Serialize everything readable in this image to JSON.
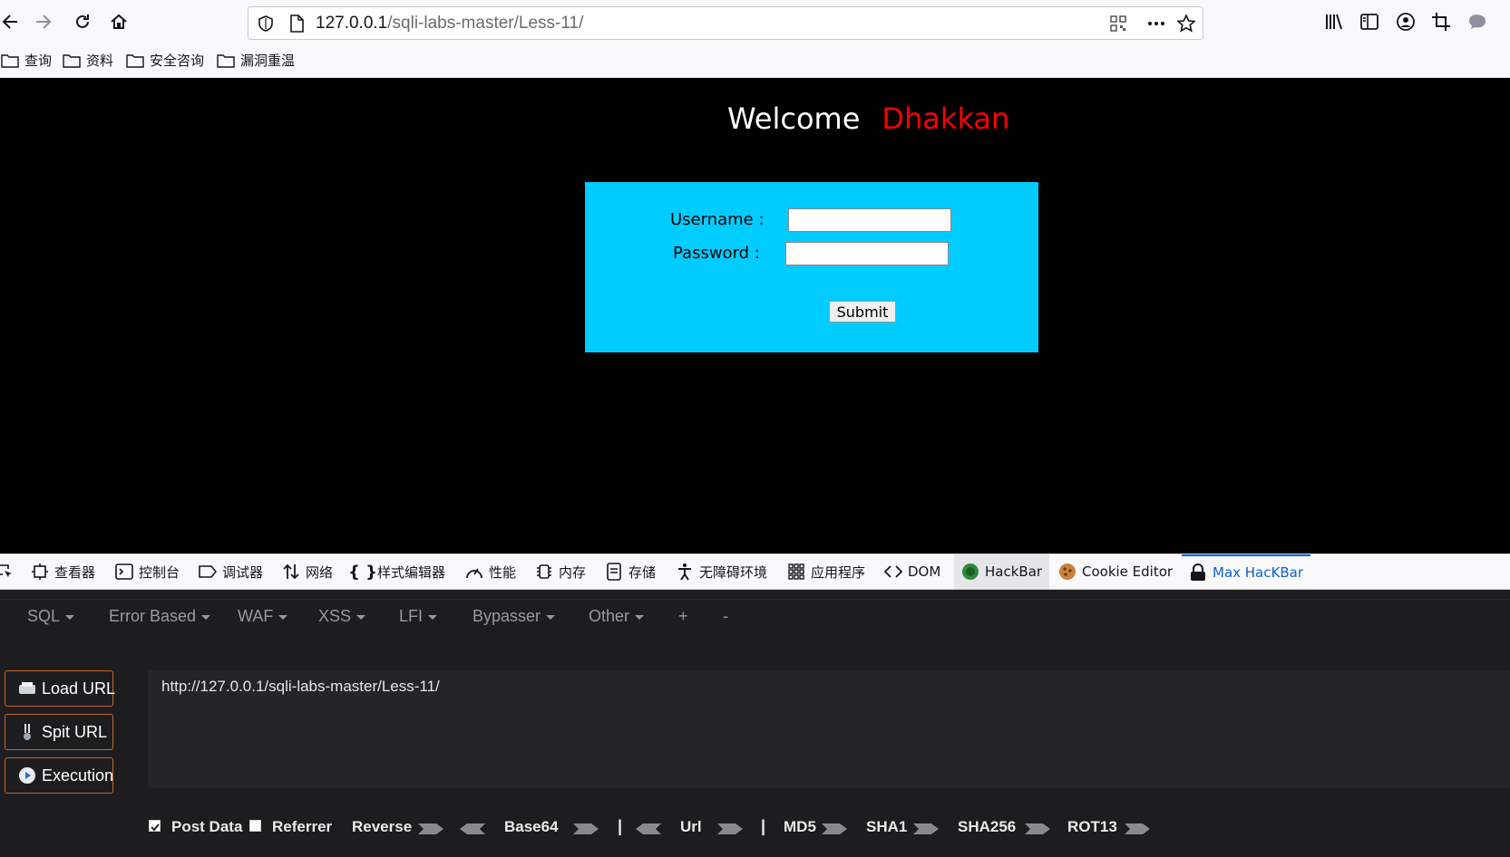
{
  "browser": {
    "url_host": "127.0.0.1",
    "url_path": "/sqli-labs-master/Less-11/"
  },
  "bookmarks": [
    {
      "label": "查询"
    },
    {
      "label": "资料"
    },
    {
      "label": "安全咨询"
    },
    {
      "label": "漏洞重温"
    }
  ],
  "page": {
    "welcome": "Welcome",
    "name": "Dhakkan",
    "username_label": "Username :",
    "password_label": "Password :",
    "username_value": "",
    "password_value": "",
    "submit_label": "Submit",
    "colors": {
      "background": "#000000",
      "form": "#00ccff",
      "name": "#ff0000"
    }
  },
  "devtools": {
    "tabs": [
      {
        "label": "查看器",
        "icon": "inspector-icon"
      },
      {
        "label": "控制台",
        "icon": "console-icon"
      },
      {
        "label": "调试器",
        "icon": "debugger-icon"
      },
      {
        "label": "网络",
        "icon": "network-icon"
      },
      {
        "label": "样式编辑器",
        "icon": "style-editor-icon"
      },
      {
        "label": "性能",
        "icon": "performance-icon"
      },
      {
        "label": "内存",
        "icon": "memory-icon"
      },
      {
        "label": "存储",
        "icon": "storage-icon"
      },
      {
        "label": "无障碍环境",
        "icon": "accessibility-icon"
      },
      {
        "label": "应用程序",
        "icon": "application-icon"
      },
      {
        "label": "DOM",
        "icon": "dom-icon"
      },
      {
        "label": "HackBar",
        "icon": "hackbar-icon"
      },
      {
        "label": "Cookie Editor",
        "icon": "cookie-icon"
      },
      {
        "label": "Max HacKBar",
        "icon": "lock-icon",
        "active": true
      }
    ]
  },
  "hackbar": {
    "menu": [
      {
        "label": "SQL",
        "caret": true
      },
      {
        "label": "Error Based",
        "caret": true
      },
      {
        "label": "WAF",
        "caret": true
      },
      {
        "label": "XSS",
        "caret": true
      },
      {
        "label": "LFI",
        "caret": true
      },
      {
        "label": "Bypasser",
        "caret": true
      },
      {
        "label": "Other",
        "caret": true
      },
      {
        "label": "+",
        "caret": false
      },
      {
        "label": "-",
        "caret": false
      }
    ],
    "buttons": {
      "load": "Load URL",
      "split": "Spit URL",
      "execute": "Execution"
    },
    "url_value": "http://127.0.0.1/sqli-labs-master/Less-11/",
    "options": {
      "post_data": "Post Data",
      "post_data_checked": true,
      "referrer": "Referrer",
      "referrer_checked": false,
      "reverse": "Reverse",
      "base64": "Base64",
      "sep1": "|",
      "url": "Url",
      "sep2": "|",
      "md5": "MD5",
      "sha1": "SHA1",
      "sha256": "SHA256",
      "rot13": "ROT13"
    },
    "colors": {
      "button_border": "#c9672b",
      "panel": "#1d1d1f"
    }
  }
}
